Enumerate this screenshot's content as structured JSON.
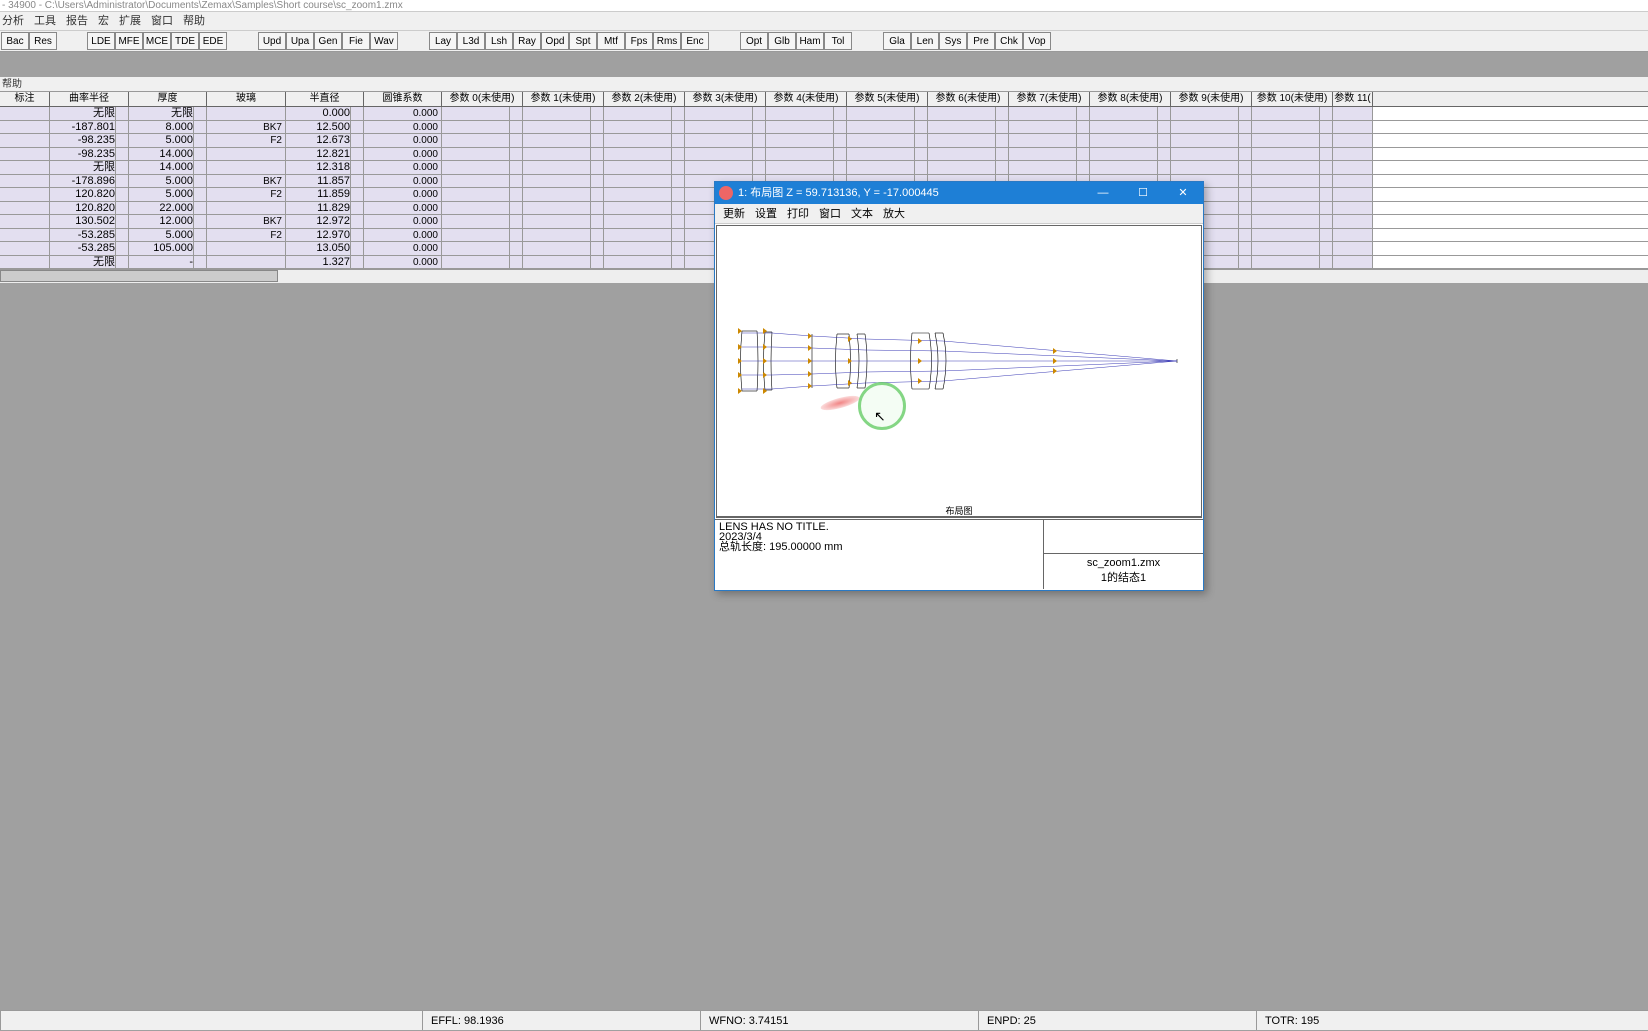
{
  "title": "- 34900 - C:\\Users\\Administrator\\Documents\\Zemax\\Samples\\Short course\\sc_zoom1.zmx",
  "menus": [
    "分析",
    "工具",
    "报告",
    "宏",
    "扩展",
    "窗口",
    "帮助"
  ],
  "toolbar": {
    "g1": [
      "Bac",
      "Res"
    ],
    "g2": [
      "LDE",
      "MFE",
      "MCE",
      "TDE",
      "EDE"
    ],
    "g3": [
      "Upd",
      "Upa",
      "Gen",
      "Fie",
      "Wav"
    ],
    "g4": [
      "Lay",
      "L3d",
      "Lsh",
      "Ray",
      "Opd",
      "Spt",
      "Mtf",
      "Fps",
      "Rms",
      "Enc"
    ],
    "g5": [
      "Opt",
      "Glb",
      "Ham",
      "Tol"
    ],
    "g6": [
      "Gla",
      "Len",
      "Sys",
      "Pre",
      "Chk",
      "Vop"
    ]
  },
  "helpLabel": "帮助",
  "grid": {
    "headers": [
      "标注",
      "曲率半径",
      "厚度",
      "玻璃",
      "半直径",
      "圆锥系数",
      "参数 0(未使用)",
      "参数 1(未使用)",
      "参数 2(未使用)",
      "参数 3(未使用)",
      "参数 4(未使用)",
      "参数 5(未使用)",
      "参数 6(未使用)",
      "参数 7(未使用)",
      "参数 8(未使用)",
      "参数 9(未使用)",
      "参数 10(未使用)",
      "参数 11("
    ],
    "rows": [
      {
        "r": "无限",
        "t": "无限",
        "g": "",
        "sd": "0.000",
        "c": "0.000"
      },
      {
        "r": "-187.801",
        "t": "8.000",
        "g": "BK7",
        "sd": "12.500",
        "c": "0.000"
      },
      {
        "r": "-98.235",
        "t": "5.000",
        "g": "F2",
        "sd": "12.673",
        "c": "0.000"
      },
      {
        "r": "-98.235",
        "t": "14.000",
        "g": "",
        "sd": "12.821",
        "c": "0.000"
      },
      {
        "r": "无限",
        "t": "14.000",
        "g": "",
        "sd": "12.318",
        "c": "0.000"
      },
      {
        "r": "-178.896",
        "t": "5.000",
        "g": "BK7",
        "sd": "11.857",
        "c": "0.000"
      },
      {
        "r": "120.820",
        "t": "5.000",
        "g": "F2",
        "sd": "11.859",
        "c": "0.000"
      },
      {
        "r": "120.820",
        "t": "22.000",
        "g": "",
        "sd": "11.829",
        "c": "0.000"
      },
      {
        "r": "130.502",
        "t": "12.000",
        "g": "BK7",
        "sd": "12.972",
        "c": "0.000"
      },
      {
        "r": "-53.285",
        "t": "5.000",
        "g": "F2",
        "sd": "12.970",
        "c": "0.000"
      },
      {
        "r": "-53.285",
        "t": "105.000",
        "g": "",
        "sd": "13.050",
        "c": "0.000"
      },
      {
        "r": "无限",
        "t": "-",
        "g": "",
        "sd": "1.327",
        "c": "0.000"
      }
    ]
  },
  "popup": {
    "title": "1: 布局图 Z = 59.713136, Y = -17.000445",
    "menus": [
      "更新",
      "设置",
      "打印",
      "窗口",
      "文本",
      "放大"
    ],
    "canvasTitle": "布局图",
    "info1": "LENS HAS NO TITLE.",
    "info2": "2023/3/4",
    "info3": "总轨长度:  195.00000 mm",
    "file": "sc_zoom1.zmx",
    "config": "1的结态1"
  },
  "status": {
    "effl": "EFFL: 98.1936",
    "wfno": "WFNO: 3.74151",
    "enpd": "ENPD: 25",
    "totr": "TOTR: 195"
  }
}
